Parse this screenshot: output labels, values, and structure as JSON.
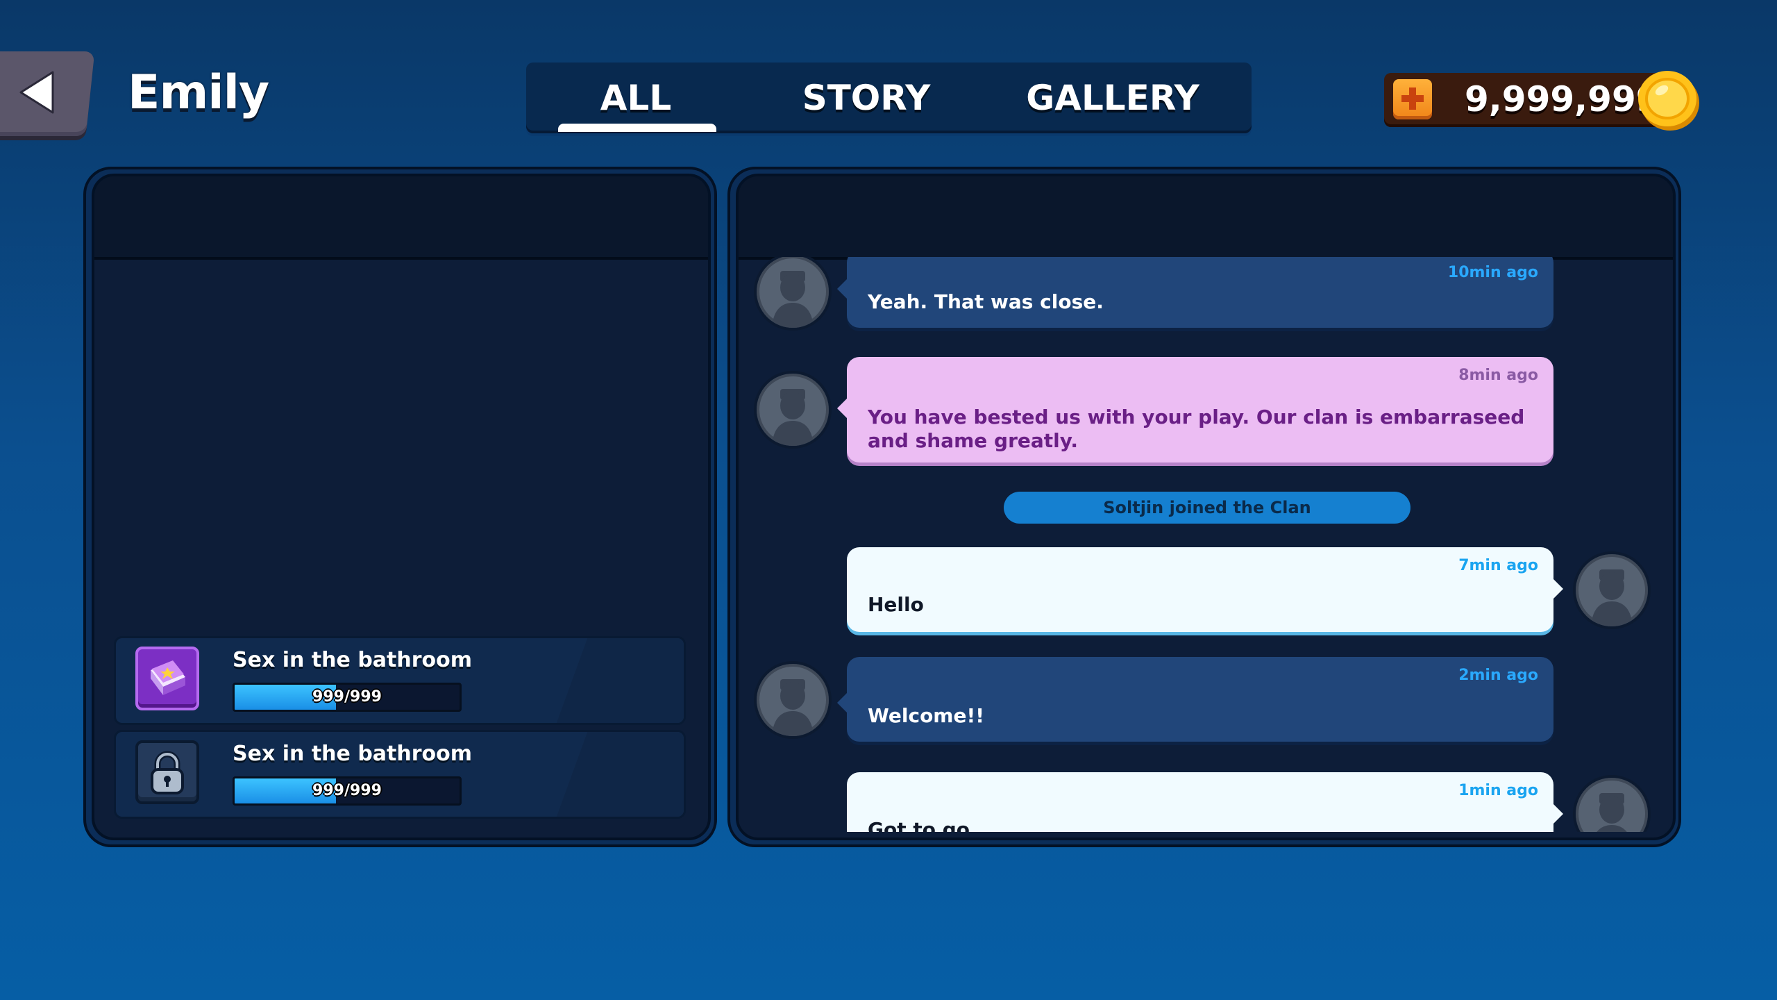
{
  "header": {
    "title": "Emily",
    "back_icon": "back-arrow-icon",
    "tabs": [
      {
        "label": "ALL",
        "active": true
      },
      {
        "label": "STORY",
        "active": false
      },
      {
        "label": "GALLERY",
        "active": false
      }
    ]
  },
  "currency": {
    "amount": "9,999,999",
    "add_icon": "plus-icon",
    "coin_icon": "gold-coin-icon"
  },
  "stories": [
    {
      "title": "Sex in the bathroom",
      "progress_text": "999/999",
      "progress": 0.45,
      "icon": "book-icon",
      "locked": false
    },
    {
      "title": "Sex in the bathroom",
      "progress_text": "999/999",
      "progress": 0.45,
      "icon": "lock-icon",
      "locked": true
    }
  ],
  "chat": {
    "messages": [
      {
        "time": "10min ago",
        "text": "Yeah. That was close.",
        "style": "dark",
        "side": "left"
      },
      {
        "time": "8min ago",
        "text_lines": [
          "You have bested us with your play. Our clan is embarraseed",
          "and shame greatly."
        ],
        "style": "pink",
        "side": "left"
      },
      {
        "time": "7min ago",
        "text": "Hello",
        "style": "white",
        "side": "right"
      },
      {
        "time": "2min ago",
        "text": "Welcome!!",
        "style": "dark",
        "side": "left"
      },
      {
        "time": "1min ago",
        "text": "Got to go",
        "style": "white",
        "side": "right"
      }
    ],
    "system_notice": "Soltjin joined the Clan"
  },
  "colors": {
    "background": "#0b4f8f",
    "accent_blue": "#2aa9ff",
    "pink_bubble": "#ecbdf3",
    "dark_bubble": "#21467a",
    "white_bubble": "#f1fbff",
    "coin": "#ffc21a",
    "book_purple": "#7c2fc4"
  }
}
